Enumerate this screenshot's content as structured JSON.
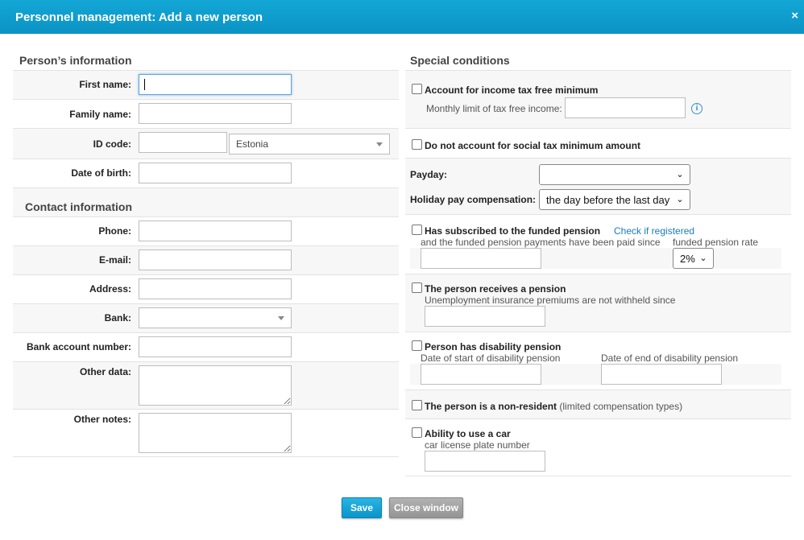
{
  "window": {
    "title": "Personnel management: Add a new person",
    "close_symbol": "×"
  },
  "person_info": {
    "title": "Person’s information",
    "first_name_label": "First name:",
    "family_name_label": "Family name:",
    "id_code_label": "ID code:",
    "country_value": "Estonia",
    "dob_label": "Date of birth:"
  },
  "contact_info": {
    "title": "Contact information",
    "phone_label": "Phone:",
    "email_label": "E-mail:",
    "address_label": "Address:",
    "bank_label": "Bank:",
    "bank_account_label": "Bank account number:",
    "other_data_label": "Other data:",
    "other_notes_label": "Other notes:"
  },
  "special": {
    "title": "Special conditions",
    "tax_free_label": "Account for income tax free minimum",
    "monthly_limit_label": "Monthly limit of tax free income:",
    "social_tax_label": "Do not account for social tax minimum amount",
    "payday_label": "Payday:",
    "payday_value": "",
    "holiday_label": "Holiday pay compensation:",
    "holiday_value": "the day before the last day",
    "funded_label": "Has subscribed to the funded pension",
    "check_registered": "Check if registered",
    "funded_since_label": "and the funded pension payments have been paid since",
    "funded_rate_label": "funded pension rate",
    "funded_rate_value": "2%",
    "pension_label": "The person receives a pension",
    "unemployment_label": "Unemployment insurance premiums are not withheld since",
    "disability_label": "Person has disability pension",
    "disability_start_label": "Date of start of disability pension",
    "disability_end_label": "Date of end of disability pension",
    "nonresident_label": "The person is a non-resident",
    "nonresident_note": "(limited compensation types)",
    "car_label": "Ability to use a car",
    "car_plate_label": "car license plate number"
  },
  "buttons": {
    "save": "Save",
    "close": "Close window"
  },
  "icons": {
    "info": "i",
    "chevron": "⌄"
  }
}
